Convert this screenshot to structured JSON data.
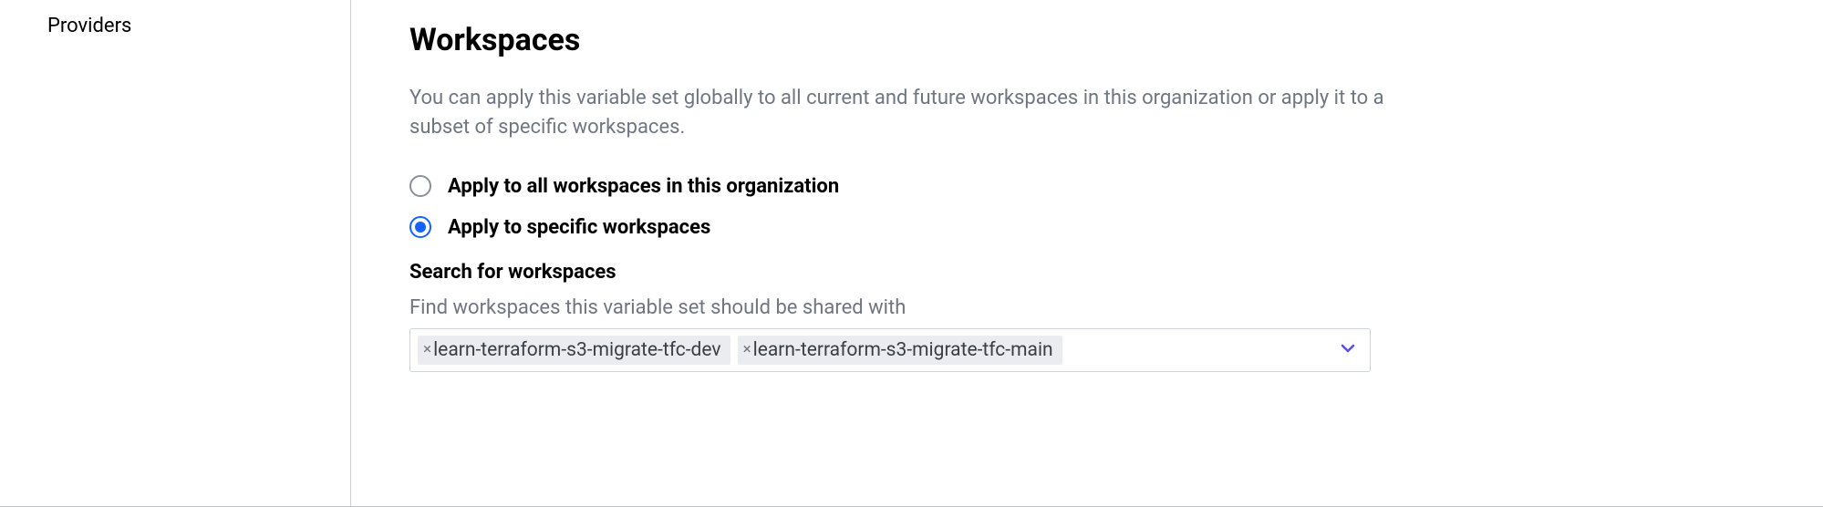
{
  "sidebar": {
    "items": [
      {
        "label": "Providers"
      }
    ]
  },
  "main": {
    "title": "Workspaces",
    "description": "You can apply this variable set globally to all current and future workspaces in this organization or apply it to a subset of specific workspaces.",
    "radio_options": [
      {
        "label": "Apply to all workspaces in this organization",
        "selected": false
      },
      {
        "label": "Apply to specific workspaces",
        "selected": true
      }
    ],
    "search": {
      "label": "Search for workspaces",
      "help_text": "Find workspaces this variable set should be shared with",
      "selected_tags": [
        "learn-terraform-s3-migrate-tfc-dev",
        "learn-terraform-s3-migrate-tfc-main"
      ]
    }
  }
}
